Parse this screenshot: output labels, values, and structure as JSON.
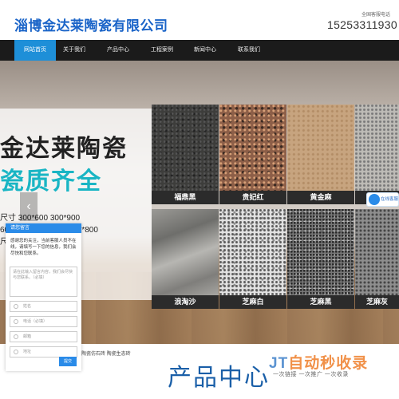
{
  "header": {
    "logo": "淄博金达莱陶瓷有限公司",
    "hotline_label": "全国客服电话",
    "hotline_number": "15253311930"
  },
  "nav": {
    "items": [
      "网站首页",
      "关于我们",
      "产品中心",
      "工程案例",
      "新闻中心",
      "联系我们"
    ],
    "active_index": 0
  },
  "banner": {
    "title": "金达莱陶瓷",
    "subtitle": "瓷质齐全",
    "sizes": [
      "尺寸  300*600  300*900",
      "600*600  600*1200  800*800",
      "尺寸"
    ],
    "prev_arrow": "‹",
    "tiles": [
      {
        "name": "福鼎黑"
      },
      {
        "name": "贵妃红"
      },
      {
        "name": "黄金麻"
      },
      {
        "name": ""
      },
      {
        "name": "浪淘沙"
      },
      {
        "name": "芝麻白"
      },
      {
        "name": "芝麻黑"
      },
      {
        "name": "芝麻灰"
      }
    ]
  },
  "chat": {
    "header": "请您留言",
    "message": "感谢您的关注，当前客服人员不在线，请填写一下您的信息，我们会尽快和您联系。",
    "textarea_placeholder": "请在此输入留言内容，我们会尽快与您联系。（必填）",
    "name_placeholder": "姓名",
    "phone_placeholder": "电话（必填）",
    "email_placeholder": "邮箱",
    "address_placeholder": "地址",
    "submit": "提交"
  },
  "online_chat": {
    "label": "在线客服"
  },
  "crumb": "陶瓷仿石砖 陶瓷生态砖",
  "section_title": "产品中心",
  "watermark": {
    "logo_prefix": "JT",
    "logo_text": "自动秒收录",
    "tagline": "一次链接 一次推广 一次收录"
  }
}
